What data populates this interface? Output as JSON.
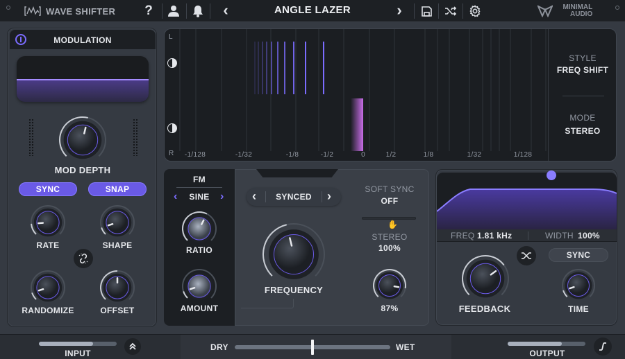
{
  "topbar": {
    "plugin_name": "WAVE SHIFTER",
    "preset_name": "ANGLE LAZER",
    "brand_line1": "MINIMAL",
    "brand_line2": "AUDIO",
    "help_icon": "?",
    "prev_preset": "‹",
    "next_preset": "›"
  },
  "modulation": {
    "title": "MODULATION",
    "mod_depth_label": "MOD DEPTH",
    "sync_label": "SYNC",
    "snap_label": "SNAP",
    "knobs": [
      {
        "label": "RATE",
        "value": 0.15
      },
      {
        "label": "SHAPE",
        "value": 0.1
      },
      {
        "label": "RANDOMIZE",
        "value": 0.1
      },
      {
        "label": "OFFSET",
        "value": 0.5
      }
    ],
    "mod_depth_value": 0.55,
    "sync_on": true,
    "snap_on": true
  },
  "scope": {
    "channel_top": "L",
    "channel_bottom": "R",
    "ticks": [
      "-1/128",
      "-1/32",
      "-1/8",
      "-1/2",
      "0",
      "1/2",
      "1/8",
      "1/32",
      "1/128"
    ],
    "style_label": "STYLE",
    "style_value": "FREQ SHIFT",
    "mode_label": "MODE",
    "mode_value": "STEREO"
  },
  "fm": {
    "title": "FM",
    "waveform": "SINE",
    "ratio_label": "RATIO",
    "ratio_value": 0.6,
    "amount_label": "AMOUNT",
    "amount_value": 0.1
  },
  "frequency": {
    "mode": "SYNCED",
    "knob_label": "FREQUENCY",
    "knob_value": 0.45,
    "soft_sync_label": "SOFT SYNC",
    "soft_sync_value": "OFF",
    "stereo_label": "STEREO",
    "stereo_value": "100%",
    "mix_value_text": "87%",
    "mix_value": 0.87
  },
  "fx": {
    "freq_label": "FREQ",
    "freq_value": "1.81 kHz",
    "width_label": "WIDTH",
    "width_value": "100%",
    "feedback_label": "FEEDBACK",
    "feedback_value": 0.7,
    "sync_label": "SYNC",
    "time_label": "TIME",
    "time_value": 0.1
  },
  "bottom": {
    "input_label": "INPUT",
    "input_level": 0.7,
    "dry_label": "DRY",
    "wet_label": "WET",
    "dry_wet": 0.5,
    "output_label": "OUTPUT",
    "output_level": 0.7
  },
  "colors": {
    "accent": "#6a5ae6",
    "accent_light": "#8a7dff",
    "magenta": "#c86de8"
  }
}
